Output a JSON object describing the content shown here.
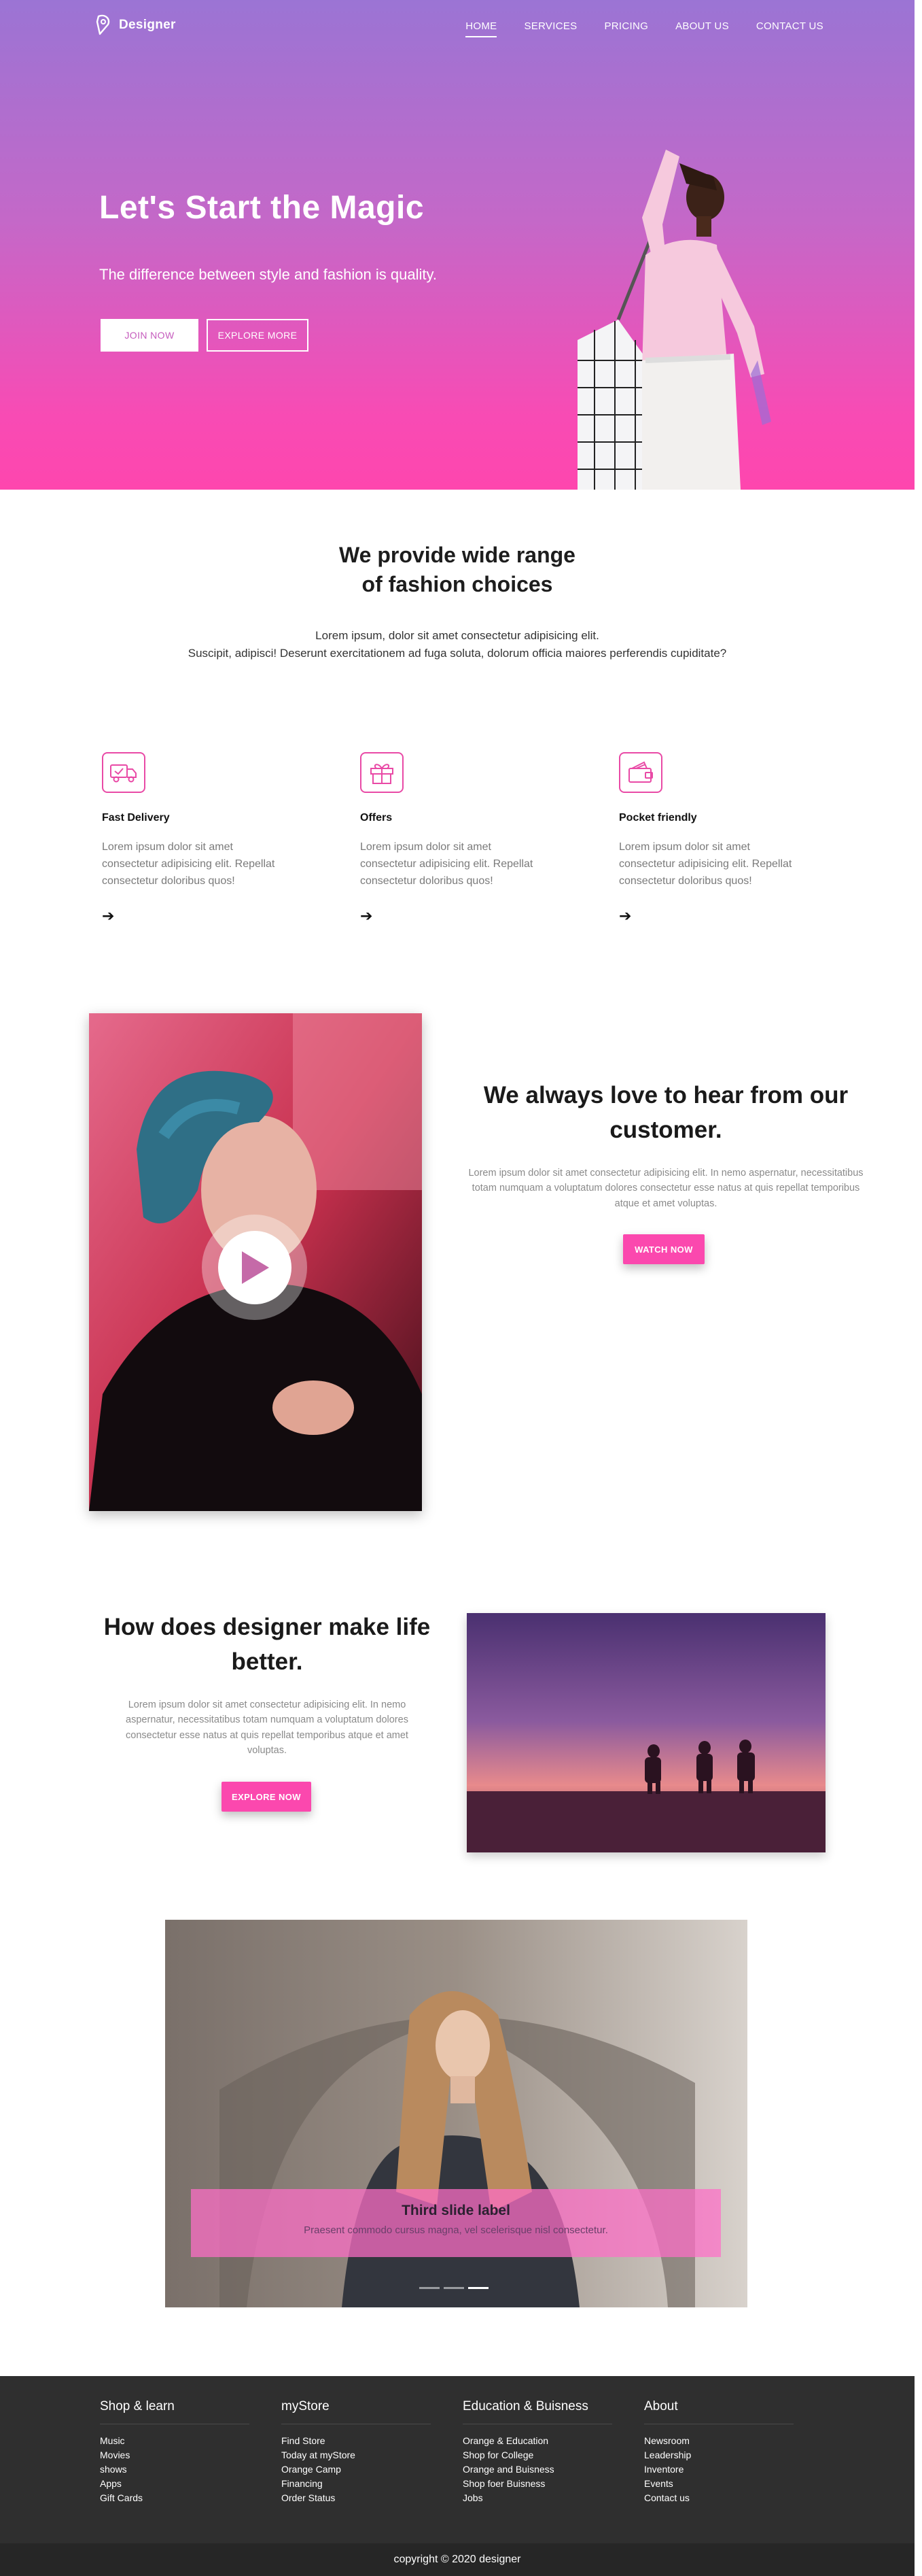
{
  "brand": {
    "name": "Designer"
  },
  "nav": {
    "items": [
      "HOME",
      "SERVICES",
      "PRICING",
      "ABOUT US",
      "CONTACT US"
    ],
    "active": "HOME"
  },
  "hero": {
    "title": "Let's Start the Magic",
    "subtitle": "The difference between style and fashion is quality.",
    "join_label": "JOIN NOW",
    "explore_label": "EXPLORE MORE"
  },
  "range": {
    "title_line1": "We provide wide range",
    "title_line2": "of fashion choices",
    "lead_line1": "Lorem ipsum, dolor sit amet consectetur adipisicing elit.",
    "lead_line2": "Suscipit, adipisci! Deserunt exercitationem ad fuga soluta, dolorum officia maiores perferendis cupiditate?"
  },
  "features": [
    {
      "icon": "delivery-truck-icon",
      "title": "Fast Delivery",
      "text": "Lorem ipsum dolor sit amet consectetur adipisicing elit. Repellat consectetur doloribus quos!"
    },
    {
      "icon": "gift-icon",
      "title": "Offers",
      "text": "Lorem ipsum dolor sit amet consectetur adipisicing elit. Repellat consectetur doloribus quos!"
    },
    {
      "icon": "wallet-icon",
      "title": "Pocket friendly",
      "text": "Lorem ipsum dolor sit amet consectetur adipisicing elit. Repellat consectetur doloribus quos!"
    }
  ],
  "video": {
    "title": "We always love to hear from our customer.",
    "text": "Lorem ipsum dolor sit amet consectetur adipisicing elit. In nemo aspernatur, necessitatibus totam numquam a voluptatum dolores consectetur esse natus at quis repellat temporibus atque et amet voluptas.",
    "button": "WATCH NOW"
  },
  "designer": {
    "title": "How does designer make life better.",
    "text": "Lorem ipsum dolor sit amet consectetur adipisicing elit. In nemo aspernatur, necessitatibus totam numquam a voluptatum dolores consectetur esse natus at quis repellat temporibus atque et amet voluptas.",
    "button": "EXPLORE NOW"
  },
  "carousel": {
    "caption_title": "Third slide label",
    "caption_text": "Praesent commodo cursus magna, vel scelerisque nisl consectetur.",
    "slide_count": 3,
    "active_slide": 3
  },
  "footer": {
    "columns": [
      {
        "title": "Shop & learn",
        "links": [
          "Music",
          "Movies",
          "shows",
          "Apps",
          "Gift Cards"
        ]
      },
      {
        "title": "myStore",
        "links": [
          "Find Store",
          "Today at myStore",
          "Orange Camp",
          "Financing",
          "Order Status"
        ]
      },
      {
        "title": "Education & Buisness",
        "links": [
          "Orange & Education",
          "Shop for College",
          "Orange and Buisness",
          "Shop foer Buisness",
          "Jobs"
        ]
      },
      {
        "title": "About",
        "links": [
          "Newsroom",
          "Leadership",
          "Inventore",
          "Events",
          "Contact us"
        ]
      }
    ],
    "copyright": "copyright © 2020 designer"
  },
  "colors": {
    "accent": "#fb48ae",
    "hero_top": "#9b74d4",
    "hero_bottom": "#fe46ae",
    "footer": "#2f2f2f"
  }
}
